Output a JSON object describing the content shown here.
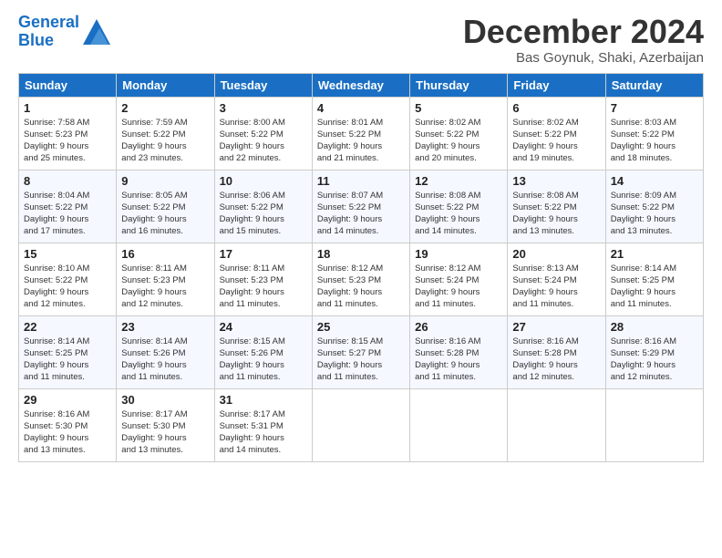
{
  "header": {
    "logo_line1": "General",
    "logo_line2": "Blue",
    "month_title": "December 2024",
    "subtitle": "Bas Goynuk, Shaki, Azerbaijan"
  },
  "days_of_week": [
    "Sunday",
    "Monday",
    "Tuesday",
    "Wednesday",
    "Thursday",
    "Friday",
    "Saturday"
  ],
  "weeks": [
    [
      {
        "day": "1",
        "info": "Sunrise: 7:58 AM\nSunset: 5:23 PM\nDaylight: 9 hours\nand 25 minutes."
      },
      {
        "day": "2",
        "info": "Sunrise: 7:59 AM\nSunset: 5:22 PM\nDaylight: 9 hours\nand 23 minutes."
      },
      {
        "day": "3",
        "info": "Sunrise: 8:00 AM\nSunset: 5:22 PM\nDaylight: 9 hours\nand 22 minutes."
      },
      {
        "day": "4",
        "info": "Sunrise: 8:01 AM\nSunset: 5:22 PM\nDaylight: 9 hours\nand 21 minutes."
      },
      {
        "day": "5",
        "info": "Sunrise: 8:02 AM\nSunset: 5:22 PM\nDaylight: 9 hours\nand 20 minutes."
      },
      {
        "day": "6",
        "info": "Sunrise: 8:02 AM\nSunset: 5:22 PM\nDaylight: 9 hours\nand 19 minutes."
      },
      {
        "day": "7",
        "info": "Sunrise: 8:03 AM\nSunset: 5:22 PM\nDaylight: 9 hours\nand 18 minutes."
      }
    ],
    [
      {
        "day": "8",
        "info": "Sunrise: 8:04 AM\nSunset: 5:22 PM\nDaylight: 9 hours\nand 17 minutes."
      },
      {
        "day": "9",
        "info": "Sunrise: 8:05 AM\nSunset: 5:22 PM\nDaylight: 9 hours\nand 16 minutes."
      },
      {
        "day": "10",
        "info": "Sunrise: 8:06 AM\nSunset: 5:22 PM\nDaylight: 9 hours\nand 15 minutes."
      },
      {
        "day": "11",
        "info": "Sunrise: 8:07 AM\nSunset: 5:22 PM\nDaylight: 9 hours\nand 14 minutes."
      },
      {
        "day": "12",
        "info": "Sunrise: 8:08 AM\nSunset: 5:22 PM\nDaylight: 9 hours\nand 14 minutes."
      },
      {
        "day": "13",
        "info": "Sunrise: 8:08 AM\nSunset: 5:22 PM\nDaylight: 9 hours\nand 13 minutes."
      },
      {
        "day": "14",
        "info": "Sunrise: 8:09 AM\nSunset: 5:22 PM\nDaylight: 9 hours\nand 13 minutes."
      }
    ],
    [
      {
        "day": "15",
        "info": "Sunrise: 8:10 AM\nSunset: 5:22 PM\nDaylight: 9 hours\nand 12 minutes."
      },
      {
        "day": "16",
        "info": "Sunrise: 8:11 AM\nSunset: 5:23 PM\nDaylight: 9 hours\nand 12 minutes."
      },
      {
        "day": "17",
        "info": "Sunrise: 8:11 AM\nSunset: 5:23 PM\nDaylight: 9 hours\nand 11 minutes."
      },
      {
        "day": "18",
        "info": "Sunrise: 8:12 AM\nSunset: 5:23 PM\nDaylight: 9 hours\nand 11 minutes."
      },
      {
        "day": "19",
        "info": "Sunrise: 8:12 AM\nSunset: 5:24 PM\nDaylight: 9 hours\nand 11 minutes."
      },
      {
        "day": "20",
        "info": "Sunrise: 8:13 AM\nSunset: 5:24 PM\nDaylight: 9 hours\nand 11 minutes."
      },
      {
        "day": "21",
        "info": "Sunrise: 8:14 AM\nSunset: 5:25 PM\nDaylight: 9 hours\nand 11 minutes."
      }
    ],
    [
      {
        "day": "22",
        "info": "Sunrise: 8:14 AM\nSunset: 5:25 PM\nDaylight: 9 hours\nand 11 minutes."
      },
      {
        "day": "23",
        "info": "Sunrise: 8:14 AM\nSunset: 5:26 PM\nDaylight: 9 hours\nand 11 minutes."
      },
      {
        "day": "24",
        "info": "Sunrise: 8:15 AM\nSunset: 5:26 PM\nDaylight: 9 hours\nand 11 minutes."
      },
      {
        "day": "25",
        "info": "Sunrise: 8:15 AM\nSunset: 5:27 PM\nDaylight: 9 hours\nand 11 minutes."
      },
      {
        "day": "26",
        "info": "Sunrise: 8:16 AM\nSunset: 5:28 PM\nDaylight: 9 hours\nand 11 minutes."
      },
      {
        "day": "27",
        "info": "Sunrise: 8:16 AM\nSunset: 5:28 PM\nDaylight: 9 hours\nand 12 minutes."
      },
      {
        "day": "28",
        "info": "Sunrise: 8:16 AM\nSunset: 5:29 PM\nDaylight: 9 hours\nand 12 minutes."
      }
    ],
    [
      {
        "day": "29",
        "info": "Sunrise: 8:16 AM\nSunset: 5:30 PM\nDaylight: 9 hours\nand 13 minutes."
      },
      {
        "day": "30",
        "info": "Sunrise: 8:17 AM\nSunset: 5:30 PM\nDaylight: 9 hours\nand 13 minutes."
      },
      {
        "day": "31",
        "info": "Sunrise: 8:17 AM\nSunset: 5:31 PM\nDaylight: 9 hours\nand 14 minutes."
      },
      {
        "day": "",
        "info": ""
      },
      {
        "day": "",
        "info": ""
      },
      {
        "day": "",
        "info": ""
      },
      {
        "day": "",
        "info": ""
      }
    ]
  ]
}
